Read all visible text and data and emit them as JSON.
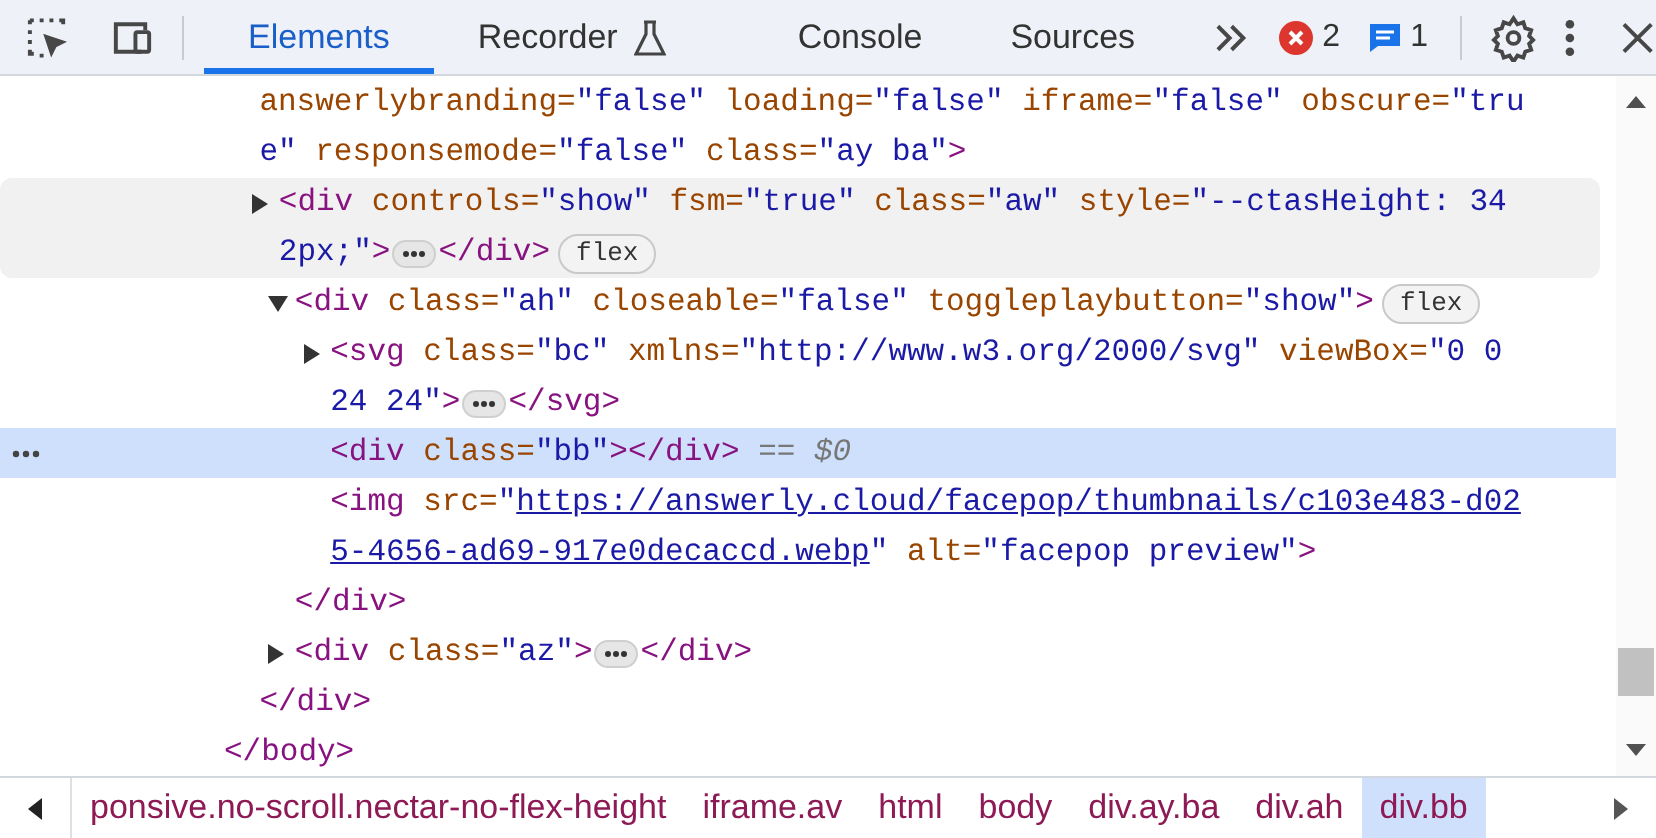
{
  "toolbar": {
    "tabs": [
      {
        "label": "Elements",
        "selected": true,
        "kind": "plain"
      },
      {
        "label": "Recorder",
        "selected": false,
        "kind": "flask"
      },
      {
        "label": "Console",
        "selected": false,
        "kind": "plain"
      },
      {
        "label": "Sources",
        "selected": false,
        "kind": "plain"
      }
    ],
    "error_count": "2",
    "message_count": "1"
  },
  "tree": [
    {
      "children": [
        {
          "lines": [
            [
              {
                "kind": "attr",
                "text": "answerlybranding="
              },
              {
                "kind": "value",
                "text": "\"false\""
              },
              {
                "kind": "attr",
                "text": " loading="
              },
              {
                "kind": "value",
                "text": "\"false\""
              },
              {
                "kind": "attr",
                "text": " iframe="
              },
              {
                "kind": "value",
                "text": "\"false\""
              },
              {
                "kind": "attr",
                "text": " obscure="
              },
              {
                "kind": "value",
                "text": "\"tru"
              }
            ],
            [
              {
                "kind": "value",
                "text": "e\""
              },
              {
                "kind": "attr",
                "text": " responsemode="
              },
              {
                "kind": "value",
                "text": "\"false\""
              },
              {
                "kind": "attr",
                "text": " class="
              },
              {
                "kind": "value",
                "text": "\"ay ba\""
              },
              {
                "kind": "tag",
                "text": ">"
              }
            ]
          ],
          "children": [
            {
              "expanded": false,
              "hovered": true,
              "lines": [
                [
                  {
                    "kind": "tag",
                    "text": "<div"
                  },
                  {
                    "kind": "attr",
                    "text": " controls="
                  },
                  {
                    "kind": "value",
                    "text": "\"show\""
                  },
                  {
                    "kind": "attr",
                    "text": " fsm="
                  },
                  {
                    "kind": "value",
                    "text": "\"true\""
                  },
                  {
                    "kind": "attr",
                    "text": " class="
                  },
                  {
                    "kind": "value",
                    "text": "\"aw\""
                  },
                  {
                    "kind": "attr",
                    "text": " style="
                  },
                  {
                    "kind": "value",
                    "text": "\"--ctasHeight: 34"
                  }
                ],
                [
                  {
                    "kind": "value",
                    "text": "2px;\""
                  },
                  {
                    "kind": "tag",
                    "text": ">"
                  },
                  {
                    "kind": "ellipsis"
                  },
                  {
                    "kind": "tag",
                    "text": "</div>"
                  },
                  {
                    "kind": "badge",
                    "text": "flex"
                  }
                ]
              ]
            },
            {
              "expanded": true,
              "lines": [
                [
                  {
                    "kind": "tag",
                    "text": "<div"
                  },
                  {
                    "kind": "attr",
                    "text": " class="
                  },
                  {
                    "kind": "value",
                    "text": "\"ah\""
                  },
                  {
                    "kind": "attr",
                    "text": " closeable="
                  },
                  {
                    "kind": "value",
                    "text": "\"false\""
                  },
                  {
                    "kind": "attr",
                    "text": " toggleplaybutton="
                  },
                  {
                    "kind": "value",
                    "text": "\"show\""
                  },
                  {
                    "kind": "tag",
                    "text": ">"
                  },
                  {
                    "kind": "badge",
                    "text": "flex"
                  }
                ]
              ],
              "children": [
                {
                  "expanded": false,
                  "lines": [
                    [
                      {
                        "kind": "tag",
                        "text": "<svg"
                      },
                      {
                        "kind": "attr",
                        "text": " class="
                      },
                      {
                        "kind": "value",
                        "text": "\"bc\""
                      },
                      {
                        "kind": "attr",
                        "text": " xmlns="
                      },
                      {
                        "kind": "value",
                        "text": "\"http://www.w3.org/2000/svg\""
                      },
                      {
                        "kind": "attr",
                        "text": " viewBox="
                      },
                      {
                        "kind": "value",
                        "text": "\"0 0"
                      }
                    ],
                    [
                      {
                        "kind": "value",
                        "text": "24 24\""
                      },
                      {
                        "kind": "tag",
                        "text": ">"
                      },
                      {
                        "kind": "ellipsis"
                      },
                      {
                        "kind": "tag",
                        "text": "</svg>"
                      }
                    ]
                  ]
                },
                {
                  "selected": true,
                  "lines": [
                    [
                      {
                        "kind": "tag",
                        "text": "<div"
                      },
                      {
                        "kind": "attr",
                        "text": " class="
                      },
                      {
                        "kind": "value",
                        "text": "\"bb\""
                      },
                      {
                        "kind": "tag",
                        "text": "></div>"
                      },
                      {
                        "kind": "comment",
                        "text": " == $0"
                      }
                    ]
                  ]
                },
                {
                  "lines": [
                    [
                      {
                        "kind": "tag",
                        "text": "<img"
                      },
                      {
                        "kind": "attr",
                        "text": " src="
                      },
                      {
                        "kind": "value",
                        "text": "\""
                      },
                      {
                        "kind": "link",
                        "text": "https://answerly.cloud/facepop/thumbnails/c103e483-d02"
                      }
                    ],
                    [
                      {
                        "kind": "link",
                        "text": "5-4656-ad69-917e0decaccd.webp"
                      },
                      {
                        "kind": "value",
                        "text": "\""
                      },
                      {
                        "kind": "attr",
                        "text": " alt="
                      },
                      {
                        "kind": "value",
                        "text": "\"facepop preview\""
                      },
                      {
                        "kind": "tag",
                        "text": ">"
                      }
                    ]
                  ]
                }
              ],
              "close": [
                {
                  "kind": "tag",
                  "text": "</div>"
                }
              ]
            },
            {
              "expanded": false,
              "lines": [
                [
                  {
                    "kind": "tag",
                    "text": "<div"
                  },
                  {
                    "kind": "attr",
                    "text": " class="
                  },
                  {
                    "kind": "value",
                    "text": "\"az\""
                  },
                  {
                    "kind": "tag",
                    "text": ">"
                  },
                  {
                    "kind": "ellipsis"
                  },
                  {
                    "kind": "tag",
                    "text": "</div>"
                  }
                ]
              ]
            }
          ],
          "close": [
            {
              "kind": "tag",
              "text": "</div>"
            }
          ]
        }
      ],
      "close": [
        {
          "kind": "tag",
          "text": "</body>"
        }
      ]
    }
  ],
  "breadcrumbs": [
    {
      "label": "ponsive.no-scroll.nectar-no-flex-height",
      "selected": false
    },
    {
      "label": "iframe.av",
      "selected": false
    },
    {
      "label": "html",
      "selected": false
    },
    {
      "label": "body",
      "selected": false
    },
    {
      "label": "div.ay.ba",
      "selected": false
    },
    {
      "label": "div.ah",
      "selected": false
    },
    {
      "label": "div.bb",
      "selected": true
    }
  ]
}
